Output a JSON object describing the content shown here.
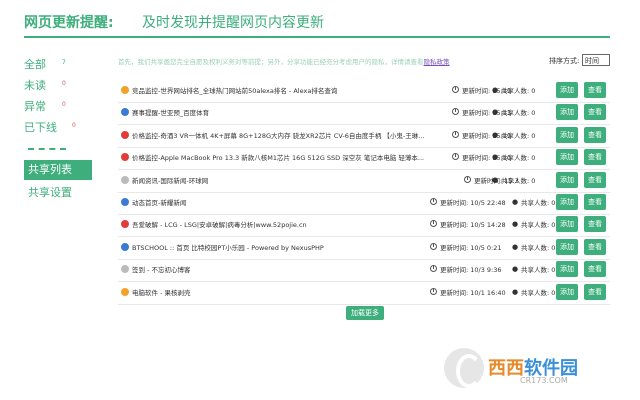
{
  "header": {
    "title": "网页更新提醒:",
    "subtitle": "及时发现并提醒网页内容更新"
  },
  "sidebar": {
    "items": [
      {
        "label": "全部",
        "count": "7"
      },
      {
        "label": "未读",
        "count": "0"
      },
      {
        "label": "异常",
        "count": "0"
      },
      {
        "label": "已下线",
        "count": "0"
      }
    ],
    "separator": "------",
    "share_list": "共享列表",
    "share_settings": "共享设置"
  },
  "notice": {
    "text": "首先，我们共享邀您完全自愿及权利义务对等前提；另外，分享功能已经充分考虑用户的隐私，详情请查看",
    "link": "隐私政策"
  },
  "sort": {
    "label": "排序方式:",
    "value": "时间"
  },
  "rows": [
    {
      "title": "竞品监控-世界网站排名_全球热门网站前50alexa排名 - Alexa排名查询",
      "time": "更新时间: 15:19",
      "share": "共享人数: 0",
      "icon_color": "#f2a12a"
    },
    {
      "title": "赛事提醒-世亚预_百度体育",
      "time": "更新时间: 15:13",
      "share": "共享人数: 0",
      "icon_color": "#3a7bd5"
    },
    {
      "title": "价格监控-奇酒3 VR一体机 4K+屏幕 8G+128G大内存 骁龙XR2芯片 CV-6自由度手柄 【小鬼-王琳...",
      "time": "更新时间: 15:19",
      "share": "共享人数: 0",
      "icon_color": "#e23b3b"
    },
    {
      "title": "价格监控-Apple MacBook Pro 13.3 新款八核M1芯片 16G 512G SSD 深空灰 笔记本电脑 轻薄本...",
      "time": "更新时间: 15:10",
      "share": "共享人数: 0",
      "icon_color": "#e23b3b"
    },
    {
      "title": "新闻资讯-国际新闻-环球网",
      "time": "更新时间: 15:3",
      "share": "共享人数: 0",
      "icon_color": "#bbbbbb"
    },
    {
      "title": "动态首页-新耀新闻",
      "time": "更新时间: 10/5 22:48",
      "share": "共享人数: 0",
      "icon_color": "#3a7bd5"
    },
    {
      "title": "吾爱破解 - LCG - LSG|安卓破解|病毒分析|www.52pojie.cn",
      "time": "更新时间: 10/5 14:28",
      "share": "共享人数: 0",
      "icon_color": "#e23b3b"
    },
    {
      "title": "BTSCHOOL :: 首页 比特校园PT小乐园 - Powered by NexusPHP",
      "time": "更新时间: 10/5 0:21",
      "share": "共享人数: 0",
      "icon_color": "#3a7bd5"
    },
    {
      "title": "签到 - 不忘初心博客",
      "time": "更新时间: 10/3 9:36",
      "share": "共享人数: 0",
      "icon_color": "#bbbbbb"
    },
    {
      "title": "电脑软件 - 果核剥壳",
      "time": "更新时间: 10/1 16:40",
      "share": "共享人数: 0",
      "icon_color": "#f2a12a"
    }
  ],
  "buttons": {
    "add": "添加",
    "view": "查看",
    "load_more": "加载更多"
  },
  "watermark": {
    "text_a": "西西",
    "text_b": "软件园",
    "url": "CR173.COM"
  }
}
